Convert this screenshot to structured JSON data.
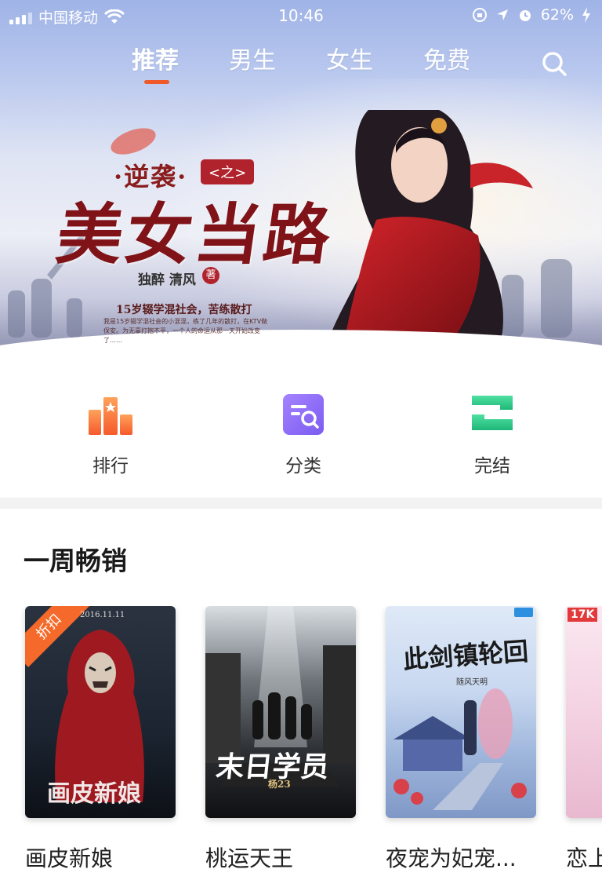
{
  "status_bar": {
    "carrier": "中国移动",
    "time": "10:46",
    "battery": "62%"
  },
  "tabs": [
    {
      "label": "推荐",
      "active": true
    },
    {
      "label": "男生",
      "active": false
    },
    {
      "label": "女生",
      "active": false
    },
    {
      "label": "免费",
      "active": false
    }
  ],
  "banner": {
    "small_title": "·逆袭·",
    "tag": "<之>",
    "title": "美女当路",
    "author": "独醉  清风",
    "author_mark": "著",
    "tagline": "15岁辍学混社会，苦练散打",
    "desc": "我是15岁辍学混社会的小混混，练了几年的散打，在KTV做保安。为无辜打抱不平，一个人的命运从那一天开始改变了……"
  },
  "quick_entries": [
    {
      "label": "排行",
      "icon": "ranking-icon"
    },
    {
      "label": "分类",
      "icon": "category-icon"
    },
    {
      "label": "完结",
      "icon": "completed-icon"
    }
  ],
  "section": {
    "title": "一周畅销"
  },
  "books": [
    {
      "title": "画皮新娘",
      "badge": "折扣",
      "cover_title": "画皮新娘",
      "cover_date": "2016.11.11"
    },
    {
      "title": "桃运天王",
      "cover_title": "末日学员",
      "cover_author": "杨23"
    },
    {
      "title": "夜宠为妃宠...",
      "cover_title": "此剑镇轮回",
      "cover_author": "随风天明"
    },
    {
      "title": "恋上",
      "cover_mark": "17K"
    }
  ],
  "colors": {
    "accent": "#f05a2a",
    "banner_red": "#b0222c"
  }
}
